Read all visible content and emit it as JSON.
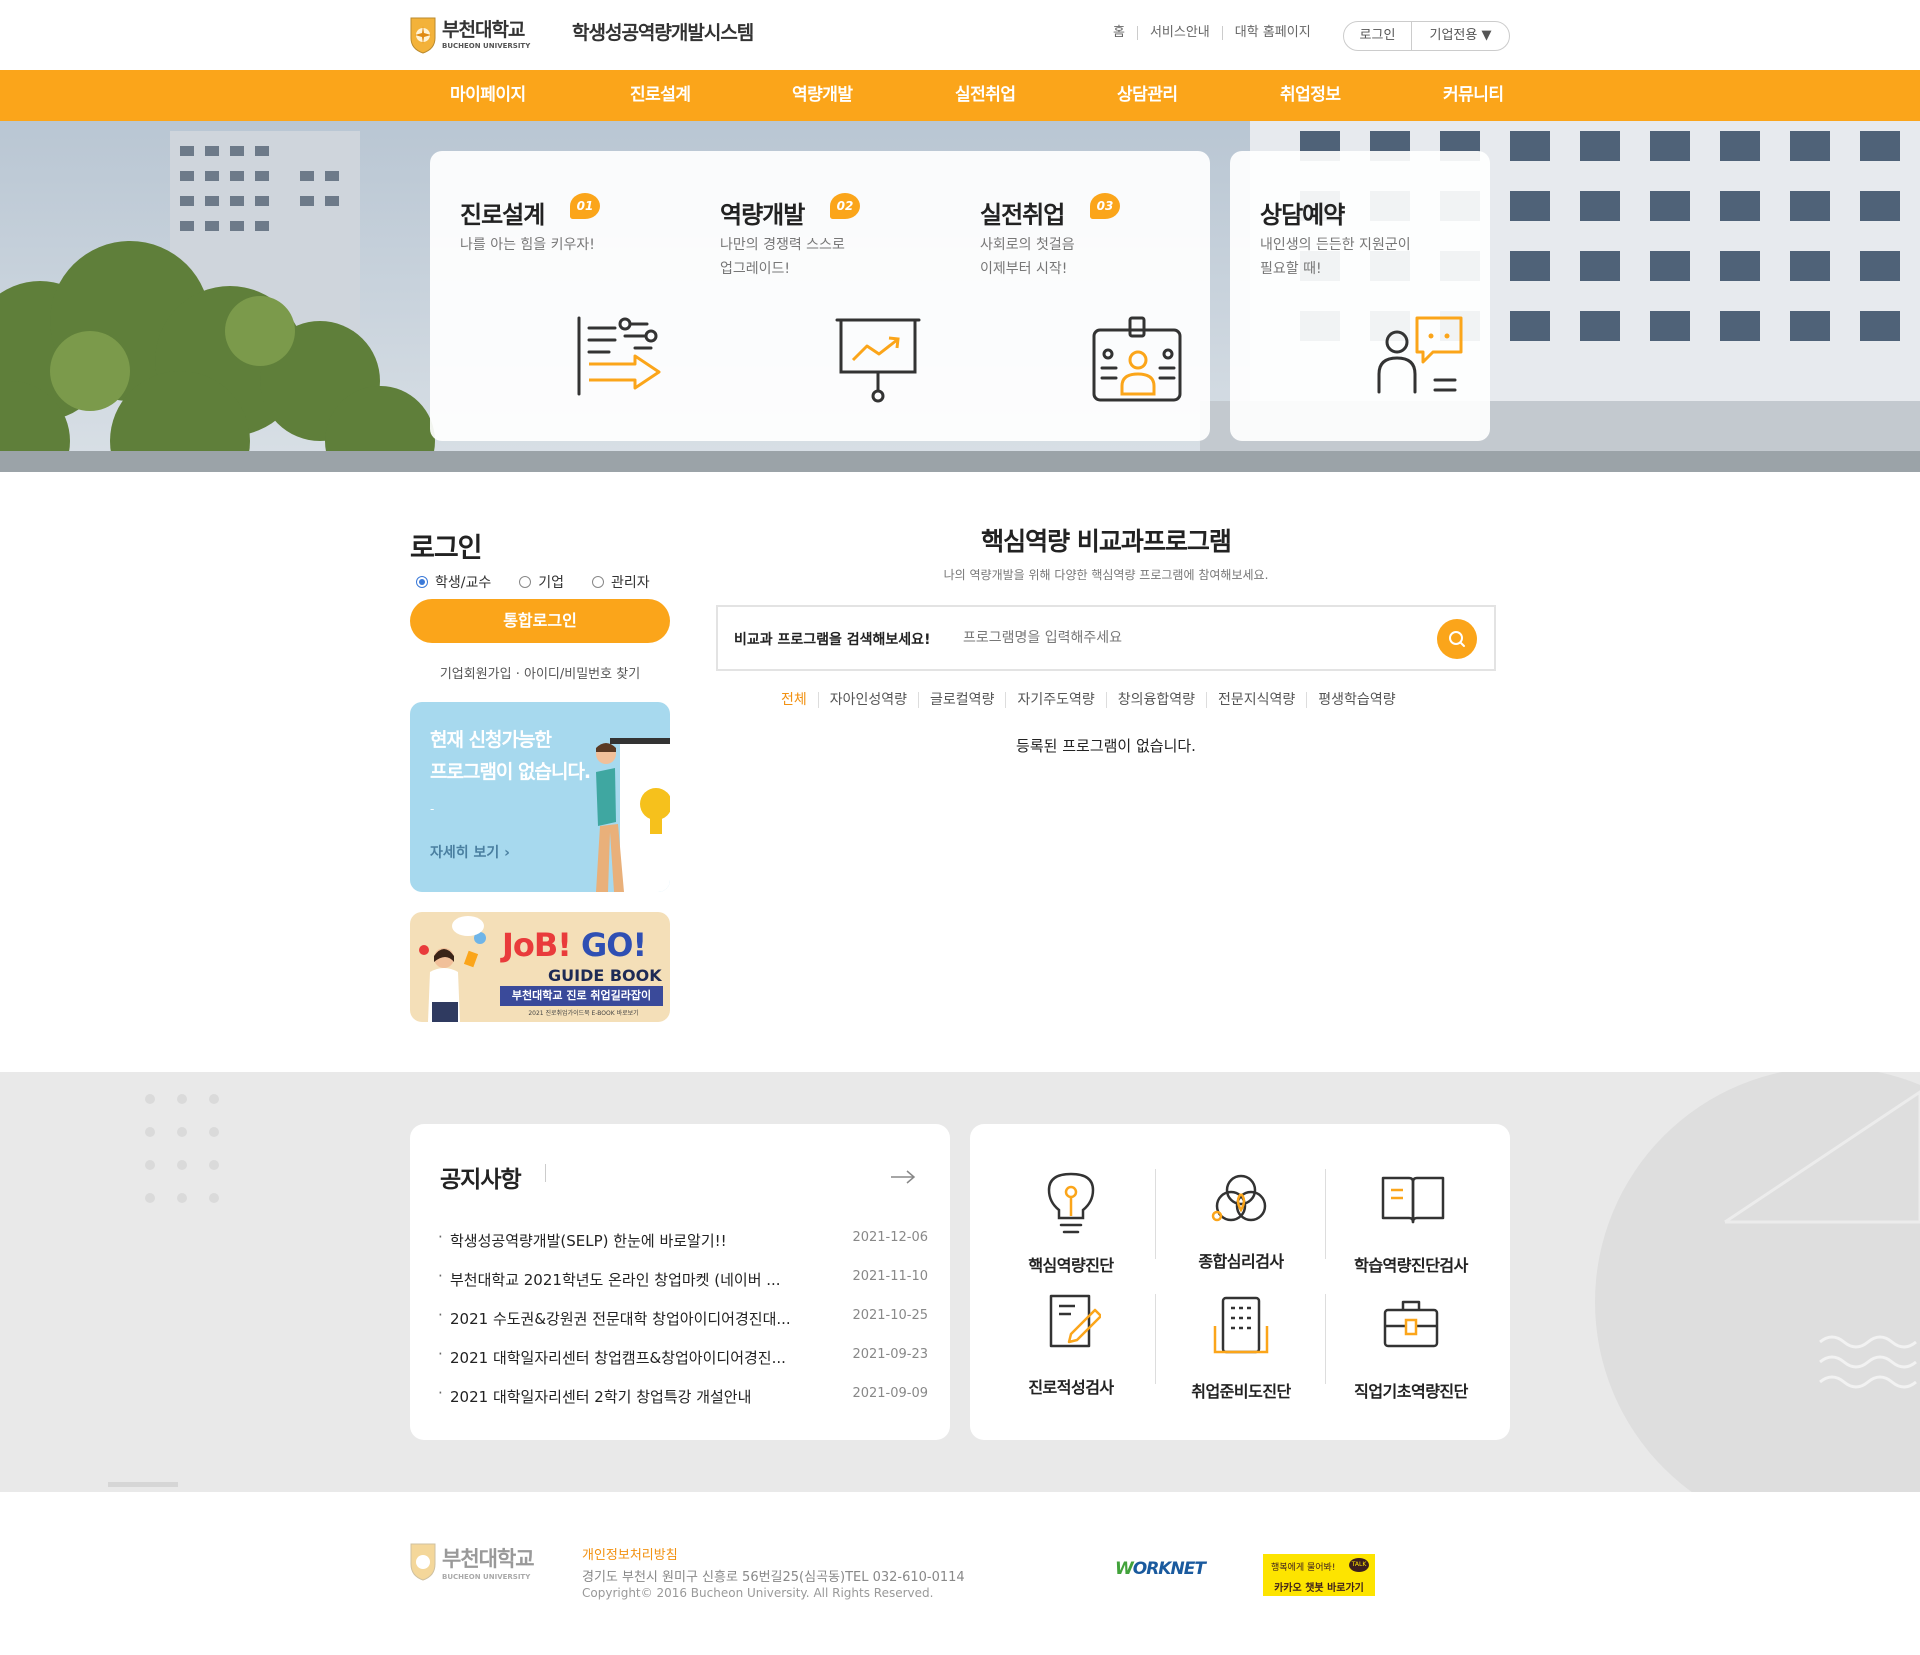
{
  "header": {
    "logo_name": "부천대학교",
    "logo_eng": "BUCHEON UNIVERSITY",
    "site_title": "학생성공역량개발시스템",
    "util_links": [
      "홈",
      "서비스안내",
      "대학 홈페이지"
    ],
    "login_label": "로그인",
    "corp_label": "기업전용 ▼"
  },
  "nav": [
    "마이페이지",
    "진로설계",
    "역량개발",
    "실전취업",
    "상담관리",
    "취업정보",
    "커뮤니티"
  ],
  "hero": {
    "cards": [
      {
        "title": "진로설계",
        "num": "01",
        "desc": "나를 아는 힘을 키우자!",
        "icon": "career-plan-icon"
      },
      {
        "title": "역량개발",
        "num": "02",
        "desc": "나만의 경쟁력 스스로\n업그레이드!",
        "icon": "presentation-chart-icon"
      },
      {
        "title": "실전취업",
        "num": "03",
        "desc": "사회로의 첫걸음\n이제부터 시작!",
        "icon": "id-badge-icon"
      },
      {
        "title": "상담예약",
        "num": "",
        "desc": "내인생의 든든한 지원군이\n필요할 때!",
        "icon": "consulting-chat-icon"
      }
    ]
  },
  "login": {
    "title": "로그인",
    "radios": [
      {
        "label": "학생/교수",
        "checked": true
      },
      {
        "label": "기업",
        "checked": false
      },
      {
        "label": "관리자",
        "checked": false
      }
    ],
    "button": "통합로그인",
    "links": "기업회원가입 · 아이디/비밀번호 찾기"
  },
  "banner1": {
    "text": "현재 신청가능한\n프로그램이 없습니다.",
    "dash": "-",
    "more": "자세히 보기 ›"
  },
  "banner2": {
    "headline_a": "JoB!",
    "headline_b": "GO!",
    "guide": "GUIDE BOOK",
    "bar": "부천대학교 진로 취업길라잡이",
    "small": "2021 진로취업가이드북 E-BOOK 바로보기"
  },
  "program": {
    "title": "핵심역량 비교과프로그램",
    "subtitle": "나의 역량개발을 위해 다양한 핵심역량 프로그램에 참여해보세요.",
    "search_label": "비교과 프로그램을 검색해보세요!",
    "search_placeholder": "프로그램명을 입력해주세요",
    "tabs": [
      "전체",
      "자아인성역량",
      "글로컬역량",
      "자기주도역량",
      "창의융합역량",
      "전문지식역량",
      "평생학습역량"
    ],
    "active_tab": "전체",
    "empty": "등록된 프로그램이 없습니다."
  },
  "notice": {
    "title": "공지사항",
    "items": [
      {
        "title": "학생성공역량개발(SELP) 한눈에 바로알기!!",
        "date": "2021-12-06"
      },
      {
        "title": "부천대학교 2021학년도 온라인 창업마켓 (네이버 ...",
        "date": "2021-11-10"
      },
      {
        "title": "2021 수도권&강원권 전문대학 창업아이디어경진대...",
        "date": "2021-10-25"
      },
      {
        "title": "2021 대학일자리센터 창업캠프&창업아이디어경진...",
        "date": "2021-09-23"
      },
      {
        "title": "2021 대학일자리센터 2학기 창업특강 개설안내",
        "date": "2021-09-09"
      }
    ]
  },
  "tests": [
    {
      "label": "핵심역량진단",
      "icon": "lightbulb-icon"
    },
    {
      "label": "종합심리검사",
      "icon": "venn-circles-icon"
    },
    {
      "label": "학습역량진단검사",
      "icon": "open-book-icon"
    },
    {
      "label": "진로적성검사",
      "icon": "document-pen-icon"
    },
    {
      "label": "취업준비도진단",
      "icon": "building-icon"
    },
    {
      "label": "직업기초역량진단",
      "icon": "briefcase-icon"
    }
  ],
  "footer": {
    "logo_name": "부천대학교",
    "logo_eng": "BUCHEON UNIVERSITY",
    "policy": "개인정보처리방침",
    "address": "경기도 부천시 원미구 신흥로 56번길25(심곡동)TEL 032-610-0114",
    "copyright": "Copyright© 2016 Bucheon University. All Rights Reserved.",
    "worknet_w": "W",
    "worknet_rest": "ORKNET",
    "kakao_top": "행복에게 물어봐!",
    "kakao_talk": "TALK",
    "kakao_bottom": "카카오 챗봇 바로가기"
  },
  "colors": {
    "accent": "#fba51a",
    "accent_text": "#f29111",
    "gray_bg": "#e9e9e9"
  }
}
